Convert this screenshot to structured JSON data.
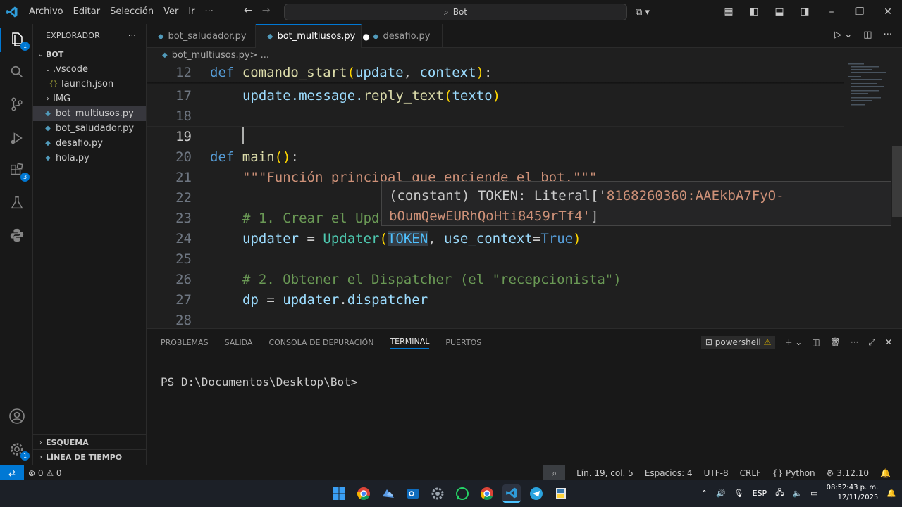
{
  "menu": [
    "Archivo",
    "Editar",
    "Selección",
    "Ver",
    "Ir",
    "···"
  ],
  "search": {
    "label": "Bot"
  },
  "explorer": {
    "title": "EXPLORADOR",
    "root": "BOT",
    "items": [
      {
        "label": ".vscode",
        "kind": "folder-open"
      },
      {
        "label": "launch.json",
        "kind": "json"
      },
      {
        "label": "IMG",
        "kind": "folder"
      },
      {
        "label": "bot_multiusos.py",
        "kind": "python"
      },
      {
        "label": "bot_saludador.py",
        "kind": "python"
      },
      {
        "label": "desafio.py",
        "kind": "python"
      },
      {
        "label": "hola.py",
        "kind": "python"
      }
    ],
    "outline": "ESQUEMA",
    "timeline": "LÍNEA DE TIEMPO"
  },
  "activity_badges": {
    "explorer": "1",
    "extensions": "3",
    "settings": "1"
  },
  "tabs": [
    {
      "label": "bot_saludador.py"
    },
    {
      "label": "bot_multiusos.py",
      "dirty": "●"
    },
    {
      "label": "desafio.py"
    }
  ],
  "breadcrumb": {
    "file": "bot_multiusos.py",
    "sep": " > ..."
  },
  "editor": {
    "line_numbers": [
      "12",
      "17",
      "18",
      "19",
      "20",
      "21",
      "22",
      "23",
      "24",
      "25",
      "26",
      "27",
      "28"
    ],
    "sticky": {
      "kw": "def",
      "fn": "comando_start",
      "p1": "update",
      "p2": "context"
    },
    "l17": {
      "obj": "update.message.",
      "fn": "reply_text",
      "arg": "texto"
    },
    "l20": {
      "kw": "def",
      "fn": "main"
    },
    "l21": "\"\"\"Función principal que enciende el bot.\"\"\"",
    "l23": "# 1. Crear el Upda",
    "l24": {
      "var": "updater",
      "cls": "Updater",
      "tok": "TOKEN",
      "kwarg": "use_context",
      "val": "True"
    },
    "l26": "# 2. Obtener el Dispatcher (el \"recepcionista\")",
    "l27": {
      "var": "dp",
      "obj": "updater",
      "attr": "dispatcher"
    }
  },
  "hover": {
    "line1_pre": "(constant) TOKEN: Literal['",
    "line1_str": "8168260360:AAEkbA7FyO-",
    "line2_str": "bOumQewEURhQoHti8459rTf4'",
    "line2_post": "]"
  },
  "panel": {
    "tabs": [
      "PROBLEMAS",
      "SALIDA",
      "CONSOLA DE DEPURACIÓN",
      "TERMINAL",
      "PUERTOS"
    ],
    "shell": "powershell",
    "prompt": "PS D:\\Documentos\\Desktop\\Bot>"
  },
  "status": {
    "errors": "⊗ 0 ⚠ 0",
    "position": "Lín. 19, col. 5",
    "spaces": "Espacios: 4",
    "encoding": "UTF-8",
    "eol": "CRLF",
    "language": "Python",
    "version": "3.12.10"
  },
  "taskbar": {
    "lang": "ESP",
    "time": "08:52:43 p. m.",
    "date": "12/11/2025"
  }
}
